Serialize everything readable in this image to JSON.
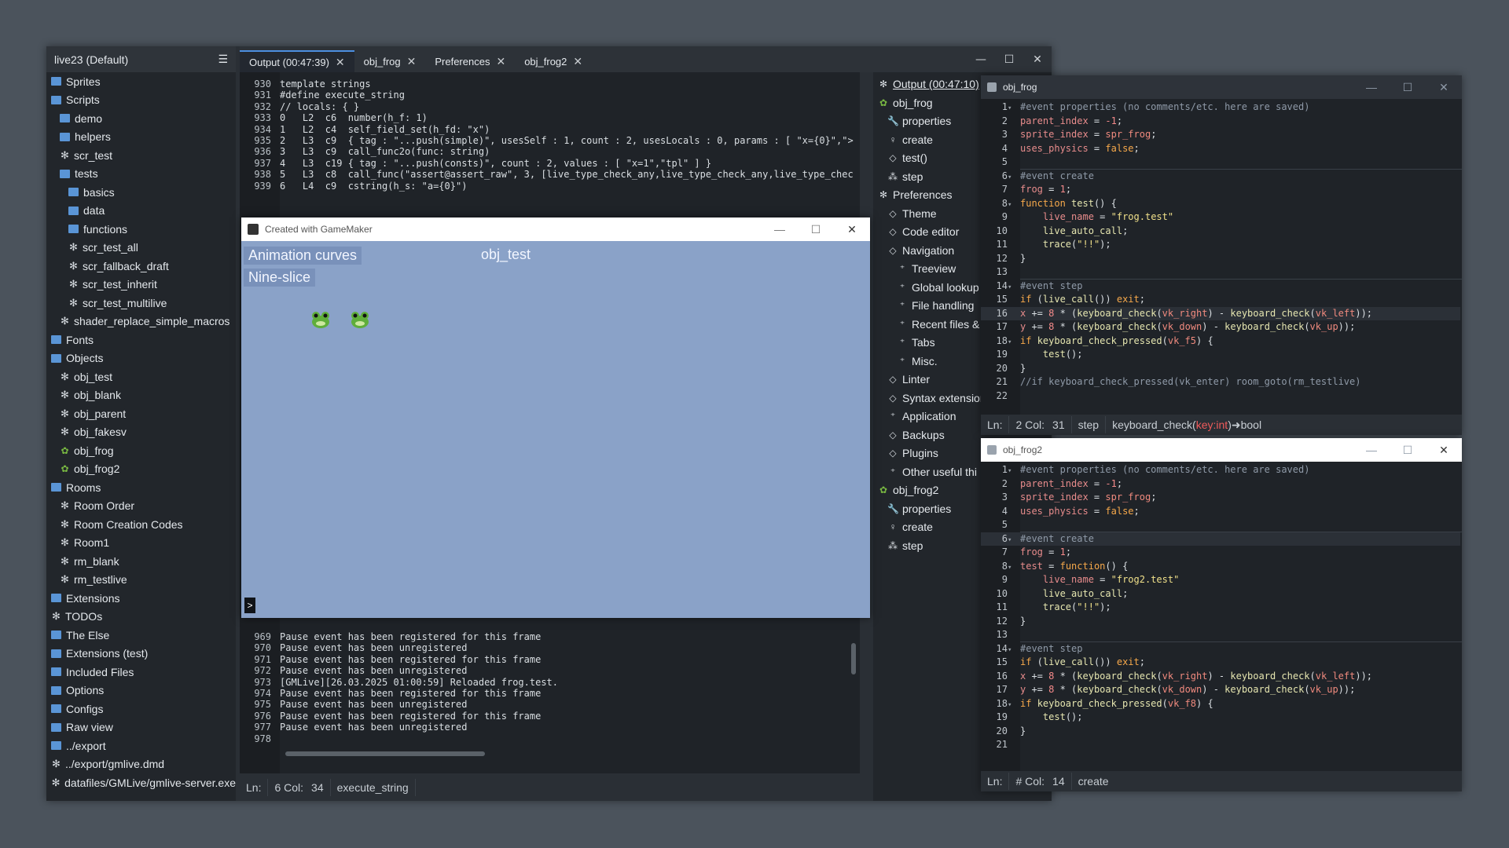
{
  "tree": {
    "title": "live23 (Default)",
    "items": [
      {
        "label": "Sprites",
        "icon": "folder",
        "indent": 0
      },
      {
        "label": "Scripts",
        "icon": "folder",
        "indent": 0
      },
      {
        "label": "demo",
        "icon": "folder",
        "indent": 1
      },
      {
        "label": "helpers",
        "icon": "folder",
        "indent": 1
      },
      {
        "label": "scr_test",
        "icon": "script",
        "indent": 1
      },
      {
        "label": "tests",
        "icon": "folder",
        "indent": 1
      },
      {
        "label": "basics",
        "icon": "folder",
        "indent": 2
      },
      {
        "label": "data",
        "icon": "folder",
        "indent": 2
      },
      {
        "label": "functions",
        "icon": "folder",
        "indent": 2
      },
      {
        "label": "scr_test_all",
        "icon": "script",
        "indent": 2
      },
      {
        "label": "scr_fallback_draft",
        "icon": "script",
        "indent": 2
      },
      {
        "label": "scr_test_inherit",
        "icon": "script",
        "indent": 2
      },
      {
        "label": "scr_test_multilive",
        "icon": "script",
        "indent": 2
      },
      {
        "label": "shader_replace_simple_macros",
        "icon": "script",
        "indent": 1
      },
      {
        "label": "Fonts",
        "icon": "folder",
        "indent": 0
      },
      {
        "label": "Objects",
        "icon": "folder",
        "indent": 0
      },
      {
        "label": "obj_test",
        "icon": "script",
        "indent": 1
      },
      {
        "label": "obj_blank",
        "icon": "script",
        "indent": 1
      },
      {
        "label": "obj_parent",
        "icon": "script",
        "indent": 1
      },
      {
        "label": "obj_fakesv",
        "icon": "script",
        "indent": 1
      },
      {
        "label": "obj_frog",
        "icon": "frog",
        "indent": 1
      },
      {
        "label": "obj_frog2",
        "icon": "frog",
        "indent": 1
      },
      {
        "label": "Rooms",
        "icon": "folder",
        "indent": 0
      },
      {
        "label": "Room Order",
        "icon": "script",
        "indent": 1
      },
      {
        "label": "Room Creation Codes",
        "icon": "script",
        "indent": 1
      },
      {
        "label": "Room1",
        "icon": "script",
        "indent": 1
      },
      {
        "label": "rm_blank",
        "icon": "script",
        "indent": 1
      },
      {
        "label": "rm_testlive",
        "icon": "script",
        "indent": 1
      },
      {
        "label": "Extensions",
        "icon": "folder",
        "indent": 0
      },
      {
        "label": "TODOs",
        "icon": "script",
        "indent": 0
      },
      {
        "label": "The Else",
        "icon": "folder",
        "indent": 0
      },
      {
        "label": "Extensions (test)",
        "icon": "folder",
        "indent": 0
      },
      {
        "label": "Included Files",
        "icon": "folder",
        "indent": 0
      },
      {
        "label": "Options",
        "icon": "folder",
        "indent": 0
      },
      {
        "label": "Configs",
        "icon": "folder",
        "indent": 0
      },
      {
        "label": "Raw view",
        "icon": "folder",
        "indent": 0
      },
      {
        "label": "../export",
        "icon": "folder",
        "indent": 0
      },
      {
        "label": "../export/gmlive.dmd",
        "icon": "script",
        "indent": 0
      },
      {
        "label": "datafiles/GMLive/gmlive-server.exe",
        "icon": "script",
        "indent": 0
      }
    ]
  },
  "tabs": [
    {
      "label": "Output (00:47:39)",
      "active": true
    },
    {
      "label": "obj_frog",
      "active": false
    },
    {
      "label": "Preferences",
      "active": false
    },
    {
      "label": "obj_frog2",
      "active": false
    }
  ],
  "window_controls": {
    "minimize": "—",
    "maximize": "☐",
    "close": "✕"
  },
  "output_top": [
    {
      "n": "930",
      "t": "template strings"
    },
    {
      "n": "931",
      "t": "#define execute_string"
    },
    {
      "n": "932",
      "t": "// locals: { }"
    },
    {
      "n": "933",
      "t": "0   L2  c6  number(h_f: 1)"
    },
    {
      "n": "934",
      "t": "1   L2  c4  self_field_set(h_fd: \"x\")"
    },
    {
      "n": "935",
      "t": "2   L3  c9  { tag : \"...push(simple)\", usesSelf : 1, count : 2, usesLocals : 0, params : [ \"x={0}\",\">"
    },
    {
      "n": "936",
      "t": "3   L3  c9  call_func2o(func: string)"
    },
    {
      "n": "937",
      "t": "4   L3  c19 { tag : \"...push(consts)\", count : 2, values : [ \"x=1\",\"tpl\" ] }"
    },
    {
      "n": "938",
      "t": "5   L3  c8  call_func(\"assert@assert_raw\", 3, [live_type_check_any,live_type_check_any,live_type_chec"
    },
    {
      "n": "939",
      "t": "6   L4  c9  cstring(h_s: \"a={0}\")"
    }
  ],
  "output_bottom": [
    {
      "n": "969",
      "t": "Pause event has been registered for this frame"
    },
    {
      "n": "970",
      "t": "Pause event has been unregistered"
    },
    {
      "n": "971",
      "t": "Pause event has been registered for this frame"
    },
    {
      "n": "972",
      "t": "Pause event has been unregistered"
    },
    {
      "n": "973",
      "t": "[GMLive][26.03.2025 01:00:59] Reloaded frog.test."
    },
    {
      "n": "974",
      "t": "Pause event has been registered for this frame"
    },
    {
      "n": "975",
      "t": "Pause event has been unregistered"
    },
    {
      "n": "976",
      "t": "Pause event has been registered for this frame"
    },
    {
      "n": "977",
      "t": "Pause event has been unregistered"
    },
    {
      "n": "978",
      "t": ""
    }
  ],
  "status": {
    "ln": "Ln:",
    "pos": "6 Col:",
    "col": "34",
    "ctx": "execute_string"
  },
  "outline": [
    {
      "label": "Output (00:47:10)",
      "glyph": "gear",
      "indent": 0,
      "link": true
    },
    {
      "label": "obj_frog",
      "glyph": "frog",
      "indent": 0
    },
    {
      "label": "properties",
      "glyph": "wrench",
      "indent": 1
    },
    {
      "label": "create",
      "glyph": "bulb",
      "indent": 1
    },
    {
      "label": "test()",
      "glyph": "diamond",
      "indent": 1
    },
    {
      "label": "step",
      "glyph": "steps",
      "indent": 1
    },
    {
      "label": "Preferences",
      "glyph": "gear",
      "indent": 0
    },
    {
      "label": "Theme",
      "glyph": "diamond",
      "indent": 1
    },
    {
      "label": "Code editor",
      "glyph": "diamond",
      "indent": 1
    },
    {
      "label": "Navigation",
      "glyph": "diamond",
      "indent": 1
    },
    {
      "label": "Treeview",
      "glyph": "plus",
      "indent": 2
    },
    {
      "label": "Global lookup",
      "glyph": "plus",
      "indent": 2
    },
    {
      "label": "File handling",
      "glyph": "plus",
      "indent": 2
    },
    {
      "label": "Recent files & s",
      "glyph": "plus",
      "indent": 2
    },
    {
      "label": "Tabs",
      "glyph": "plus",
      "indent": 2
    },
    {
      "label": "Misc.",
      "glyph": "plus",
      "indent": 2
    },
    {
      "label": "Linter",
      "glyph": "diamond",
      "indent": 1
    },
    {
      "label": "Syntax extension",
      "glyph": "diamond",
      "indent": 1
    },
    {
      "label": "Application",
      "glyph": "plus",
      "indent": 1
    },
    {
      "label": "Backups",
      "glyph": "diamond",
      "indent": 1
    },
    {
      "label": "Plugins",
      "glyph": "diamond",
      "indent": 1
    },
    {
      "label": "Other useful thi",
      "glyph": "plus",
      "indent": 1
    },
    {
      "label": "obj_frog2",
      "glyph": "frog",
      "indent": 0
    },
    {
      "label": "properties",
      "glyph": "wrench",
      "indent": 1
    },
    {
      "label": "create",
      "glyph": "bulb",
      "indent": 1
    },
    {
      "label": "step",
      "glyph": "steps",
      "indent": 1
    }
  ],
  "game": {
    "title": "Created with GameMaker",
    "btn1": "Animation curves",
    "btn2": "Nine-slice",
    "label": "obj_test",
    "prompt": ">"
  },
  "frog1": {
    "title": "obj_frog",
    "status": {
      "ln": "Ln:",
      "pos": "2 Col:",
      "col": "31",
      "ctx": "step",
      "sig_a": "keyboard_check(",
      "sig_b": "key:int",
      "sig_c": ")➜bool"
    },
    "lines": [
      {
        "n": "1",
        "fold": "▾",
        "h": "<span class='c'>#event properties (no comments/etc. here are saved)</span>"
      },
      {
        "n": "2",
        "fold": "",
        "h": "<span class='v'>parent_index</span> = <span class='n'>-1</span>;"
      },
      {
        "n": "3",
        "fold": "",
        "h": "<span class='v'>sprite_index</span> = <span class='r'>spr_frog</span>;"
      },
      {
        "n": "4",
        "fold": "",
        "h": "<span class='v'>uses_physics</span> = <span class='k'>false</span>;"
      },
      {
        "n": "5",
        "fold": "",
        "h": ""
      },
      {
        "n": "6",
        "fold": "▾",
        "h": "<span class='c'>#event create</span>"
      },
      {
        "n": "7",
        "fold": "",
        "h": "<span class='v'>frog</span> = <span class='n'>1</span>;"
      },
      {
        "n": "8",
        "fold": "▾",
        "h": "<span class='k'>function</span> <span class='f'>test</span>() {"
      },
      {
        "n": "9",
        "fold": "",
        "h": "    <span class='v'>live_name</span> = <span class='s'>\"frog.test\"</span>"
      },
      {
        "n": "10",
        "fold": "",
        "h": "    <span class='f'>live_auto_call</span>;"
      },
      {
        "n": "11",
        "fold": "",
        "h": "    <span class='f'>trace</span>(<span class='s'>\"!!\"</span>);"
      },
      {
        "n": "12",
        "fold": "",
        "h": "}"
      },
      {
        "n": "13",
        "fold": "",
        "h": ""
      },
      {
        "n": "14",
        "fold": "▾",
        "h": "<span class='c'>#event step</span>"
      },
      {
        "n": "15",
        "fold": "",
        "h": "<span class='k'>if</span> (<span class='f'>live_call</span>()) <span class='k'>exit</span>;"
      },
      {
        "n": "16",
        "fold": "",
        "cur": true,
        "h": "<span class='v'>x</span> += <span class='n'>8</span> * (<span class='f'>keyboard_check</span>(<span class='r'>vk_right</span>) - <span class='f'>keyboard_check</span>(<span class='r'>vk_left</span>));"
      },
      {
        "n": "17",
        "fold": "",
        "h": "<span class='v'>y</span> += <span class='n'>8</span> * (<span class='f'>keyboard_check</span>(<span class='r'>vk_down</span>) - <span class='f'>keyboard_check</span>(<span class='r'>vk_up</span>));"
      },
      {
        "n": "18",
        "fold": "▾",
        "h": "<span class='k'>if</span> <span class='f'>keyboard_check_pressed</span>(<span class='r'>vk_f5</span>) {"
      },
      {
        "n": "19",
        "fold": "",
        "h": "    <span class='f'>test</span>();"
      },
      {
        "n": "20",
        "fold": "",
        "h": "}"
      },
      {
        "n": "21",
        "fold": "",
        "h": "<span class='c'>//if keyboard_check_pressed(vk_enter) room_goto(rm_testlive)</span>"
      },
      {
        "n": "22",
        "fold": "",
        "h": ""
      }
    ]
  },
  "frog2": {
    "title": "obj_frog2",
    "status": {
      "ln": "Ln:",
      "pos": "# Col:",
      "col": "14",
      "ctx": "create"
    },
    "lines": [
      {
        "n": "1",
        "fold": "▾",
        "h": "<span class='c'>#event properties (no comments/etc. here are saved)</span>"
      },
      {
        "n": "2",
        "fold": "",
        "h": "<span class='v'>parent_index</span> = <span class='n'>-1</span>;"
      },
      {
        "n": "3",
        "fold": "",
        "h": "<span class='v'>sprite_index</span> = <span class='r'>spr_frog</span>;"
      },
      {
        "n": "4",
        "fold": "",
        "h": "<span class='v'>uses_physics</span> = <span class='k'>false</span>;"
      },
      {
        "n": "5",
        "fold": "",
        "h": ""
      },
      {
        "n": "6",
        "fold": "▾",
        "cur": true,
        "h": "<span class='c'>#event create</span>"
      },
      {
        "n": "7",
        "fold": "",
        "h": "<span class='v'>frog</span> = <span class='n'>1</span>;"
      },
      {
        "n": "8",
        "fold": "▾",
        "h": "<span class='v'>test</span> = <span class='k'>function</span>() {"
      },
      {
        "n": "9",
        "fold": "",
        "h": "    <span class='v'>live_name</span> = <span class='s'>\"frog2.test\"</span>"
      },
      {
        "n": "10",
        "fold": "",
        "h": "    <span class='f'>live_auto_call</span>;"
      },
      {
        "n": "11",
        "fold": "",
        "h": "    <span class='f'>trace</span>(<span class='s'>\"!!\"</span>);"
      },
      {
        "n": "12",
        "fold": "",
        "h": "}"
      },
      {
        "n": "13",
        "fold": "",
        "h": ""
      },
      {
        "n": "14",
        "fold": "▾",
        "h": "<span class='c'>#event step</span>"
      },
      {
        "n": "15",
        "fold": "",
        "h": "<span class='k'>if</span> (<span class='f'>live_call</span>()) <span class='k'>exit</span>;"
      },
      {
        "n": "16",
        "fold": "",
        "h": "<span class='v'>x</span> += <span class='n'>8</span> * (<span class='f'>keyboard_check</span>(<span class='r'>vk_right</span>) - <span class='f'>keyboard_check</span>(<span class='r'>vk_left</span>));"
      },
      {
        "n": "17",
        "fold": "",
        "h": "<span class='v'>y</span> += <span class='n'>8</span> * (<span class='f'>keyboard_check</span>(<span class='r'>vk_down</span>) - <span class='f'>keyboard_check</span>(<span class='r'>vk_up</span>));"
      },
      {
        "n": "18",
        "fold": "▾",
        "h": "<span class='k'>if</span> <span class='f'>keyboard_check_pressed</span>(<span class='r'>vk_f8</span>) {"
      },
      {
        "n": "19",
        "fold": "",
        "h": "    <span class='f'>test</span>();"
      },
      {
        "n": "20",
        "fold": "",
        "h": "}"
      },
      {
        "n": "21",
        "fold": "",
        "h": ""
      }
    ]
  },
  "icons": {
    "menu": "hamburger-icon",
    "close": "close-icon"
  }
}
